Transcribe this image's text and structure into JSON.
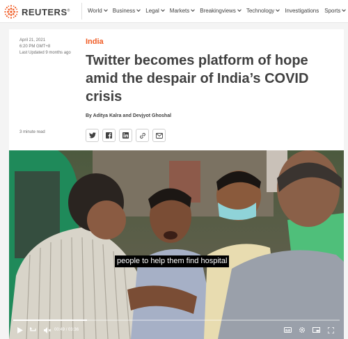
{
  "brand": {
    "name": "REUTERS",
    "reg": "®",
    "accent": "#f05a22"
  },
  "nav": {
    "items": [
      {
        "label": "World",
        "dropdown": true
      },
      {
        "label": "Business",
        "dropdown": true
      },
      {
        "label": "Legal",
        "dropdown": true
      },
      {
        "label": "Markets",
        "dropdown": true
      },
      {
        "label": "Breakingviews",
        "dropdown": true
      },
      {
        "label": "Technology",
        "dropdown": true
      },
      {
        "label": "Investigations",
        "dropdown": false
      },
      {
        "label": "Sports",
        "dropdown": true
      }
    ]
  },
  "article": {
    "date": "April 21, 2021",
    "time": "6:20 PM GMT+8",
    "updated": "Last Updated 9 months ago",
    "kicker": "India",
    "headline": "Twitter becomes platform of hope amid the despair of India’s COVID crisis",
    "byline": "By Aditya Kalra and Devjyot Ghoshal",
    "read_time": "3 minute read",
    "share_icons": [
      "twitter-icon",
      "facebook-icon",
      "linkedin-icon",
      "link-icon",
      "email-icon"
    ]
  },
  "video": {
    "caption": "people to help them find hospital",
    "current_time": "00:49",
    "separator": "/",
    "duration": "03:36",
    "progress": 0.227
  }
}
